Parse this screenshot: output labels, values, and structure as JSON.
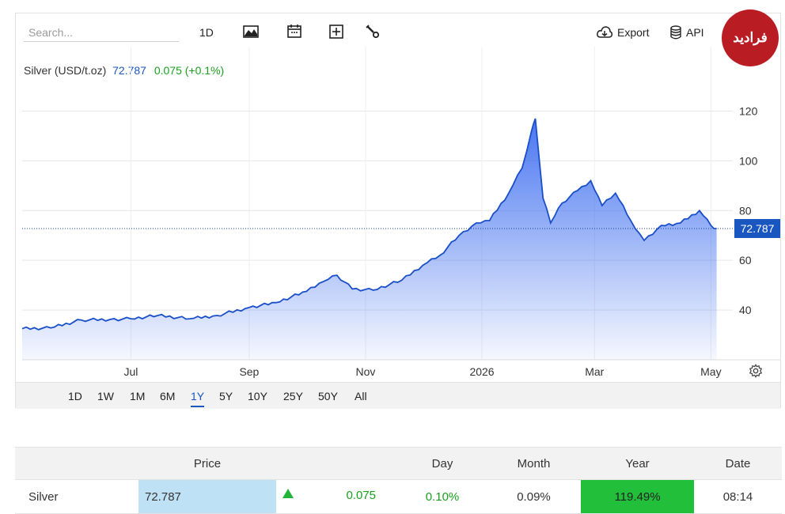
{
  "toolbar": {
    "search_placeholder": "Search...",
    "period_label": "1D",
    "export_label": "Export",
    "api_label": "API"
  },
  "logo_text": "فرادید",
  "legend": {
    "name": "Silver (USD/t.oz)",
    "price": "72.787",
    "change": "0.075 (+0.1%)"
  },
  "ranges": [
    "1D",
    "1W",
    "1M",
    "6M",
    "1Y",
    "5Y",
    "10Y",
    "25Y",
    "50Y",
    "All"
  ],
  "active_range": "1Y",
  "colors": {
    "line": "#1a4fc9",
    "fill": "#3f6ff0",
    "up": "#19a11d",
    "price_tag": "#1a56c0",
    "year_cell": "#22c03a",
    "price_cell": "#bfe1f5"
  },
  "chart_data": {
    "type": "area",
    "title": "",
    "xlabel": "",
    "ylabel": "",
    "x_ticks": [
      "Jul",
      "Sep",
      "Nov",
      "2026",
      "Mar",
      "May"
    ],
    "y_ticks": [
      40,
      60,
      80,
      100,
      120
    ],
    "ylim": [
      20,
      130
    ],
    "last_value_label": "72.787",
    "series": [
      {
        "name": "Silver (USD/t.oz)",
        "x": [
          "2025-05-05",
          "2025-05-20",
          "2025-06-05",
          "2025-06-20",
          "2025-07-01",
          "2025-07-15",
          "2025-08-01",
          "2025-08-15",
          "2025-09-01",
          "2025-09-15",
          "2025-10-01",
          "2025-10-10",
          "2025-10-17",
          "2025-10-25",
          "2025-11-05",
          "2025-11-20",
          "2025-12-01",
          "2025-12-10",
          "2025-12-20",
          "2025-12-29",
          "2026-01-05",
          "2026-01-15",
          "2026-01-22",
          "2026-01-27",
          "2026-01-29",
          "2026-02-02",
          "2026-02-06",
          "2026-02-12",
          "2026-02-20",
          "2026-02-27",
          "2026-03-05",
          "2026-03-12",
          "2026-03-20",
          "2026-03-27",
          "2026-04-05",
          "2026-04-15",
          "2026-04-25",
          "2026-05-01",
          "2026-05-04"
        ],
        "y": [
          32.5,
          32.8,
          36.0,
          36.2,
          36.5,
          37.8,
          36.5,
          37.8,
          41.0,
          43.0,
          47.5,
          51.5,
          54.0,
          48.5,
          48.0,
          52.0,
          58.0,
          62.0,
          70.0,
          75.0,
          76.0,
          87.0,
          97.0,
          112.0,
          117.0,
          85.0,
          75.0,
          83.0,
          88.0,
          92.0,
          82.0,
          87.0,
          76.0,
          68.0,
          74.0,
          75.0,
          80.0,
          74.0,
          72.787
        ]
      }
    ]
  },
  "quotes_table": {
    "headers": {
      "price": "Price",
      "day": "Day",
      "month": "Month",
      "year": "Year",
      "date": "Date"
    },
    "row": {
      "name": "Silver",
      "price": "72.787",
      "change": "0.075",
      "day": "0.10%",
      "month": "0.09%",
      "year": "119.49%",
      "date": "08:14"
    }
  }
}
